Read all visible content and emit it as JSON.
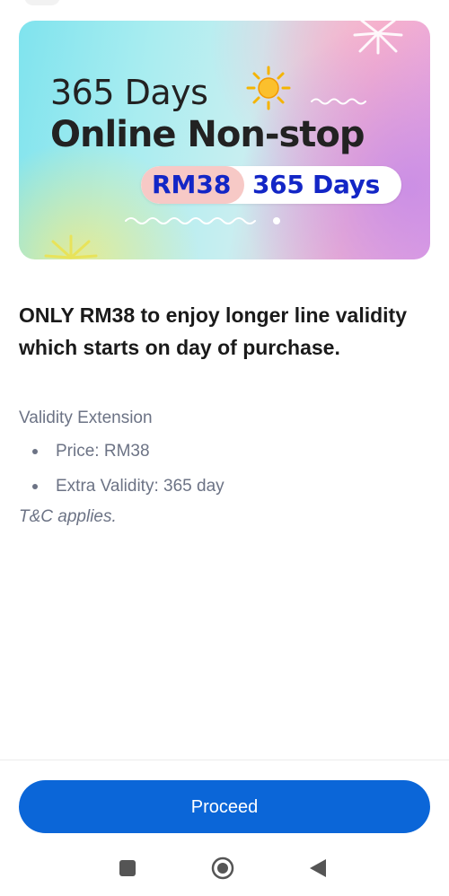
{
  "banner": {
    "title_line1": "365 Days",
    "title_line2": "Online Non-stop",
    "price_badge": "RM38",
    "days_badge": "365 Days",
    "icons": [
      "sun-icon",
      "sparkle-icon",
      "burst-icon"
    ],
    "colors": {
      "badge_text": "#1326c6",
      "badge_left_bg": "#f7c9c6",
      "title_text": "#222222"
    }
  },
  "content": {
    "headline": "ONLY RM38 to enjoy longer line validity which starts on day of purchase.",
    "section_title": "Validity Extension",
    "bullets": [
      "Price: RM38",
      "Extra Validity: 365 day"
    ],
    "terms": "T&C applies."
  },
  "footer": {
    "proceed_label": "Proceed",
    "button_color": "#0b66d8"
  },
  "navbar": {
    "icons": [
      "recents-icon",
      "home-icon",
      "back-icon"
    ]
  }
}
